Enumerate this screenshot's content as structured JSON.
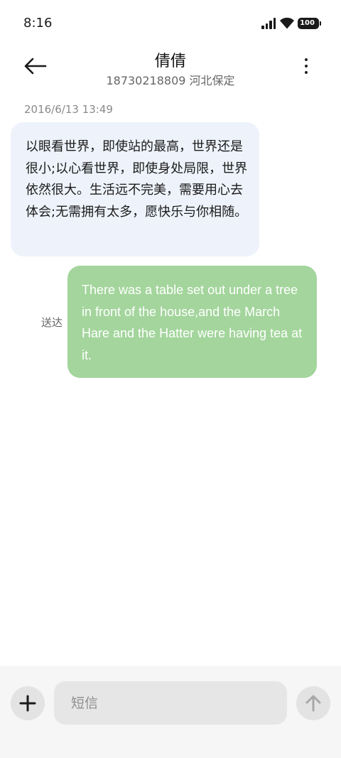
{
  "status_bar": {
    "time": "8:16",
    "battery": "100"
  },
  "header": {
    "contact_name": "倩倩",
    "contact_detail": "18730218809 河北保定"
  },
  "conversation": {
    "timestamp": "2016/6/13 13:49",
    "incoming_message": "以眼看世界，即使站的最高，世界还是很小;以心看世界，即使身处局限，世界依然很大。生活远不完美，需要用心去体会;无需拥有太多，愿快乐与你相随。",
    "outgoing_message": "There was a table set out under a tree in front of the house,and the March Hare and the Hatter were having tea at it.",
    "delivery_status": "送达"
  },
  "composer": {
    "placeholder": "短信",
    "value": ""
  },
  "colors": {
    "incoming_bubble": "#eef3fb",
    "outgoing_bubble": "#a3d59c",
    "composer_bg": "#f6f6f6"
  },
  "icons": {
    "back": "arrow-left-icon",
    "more": "more-vertical-icon",
    "add": "plus-icon",
    "send": "arrow-up-icon"
  }
}
